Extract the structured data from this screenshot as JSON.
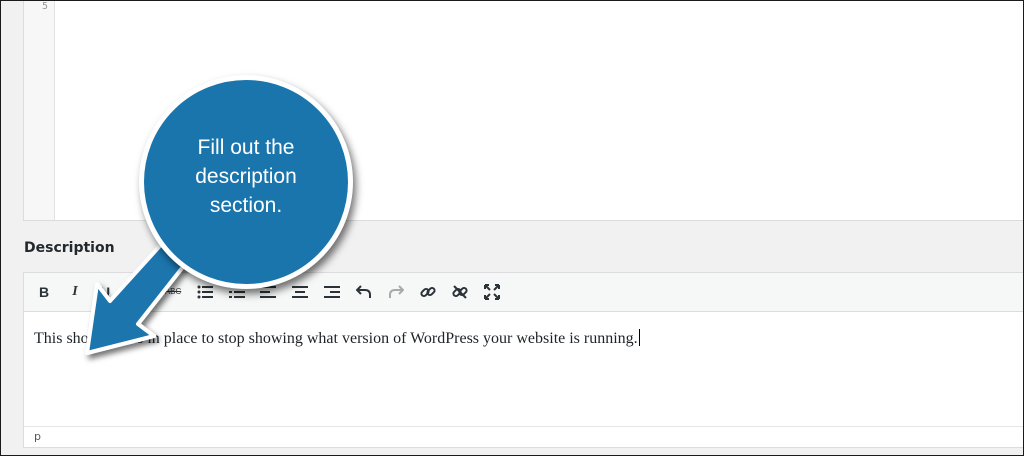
{
  "code_editor": {
    "line_number": "5"
  },
  "description_heading": "Description",
  "toolbar": {
    "bold_label": "B",
    "italic_label": "I",
    "underline_label": "U",
    "strike_label": "ABC"
  },
  "editor": {
    "content": "This shortcode is in place to stop showing what version of WordPress your website is running.",
    "path": "p"
  },
  "callout": {
    "text": "Fill out the description section.",
    "color": "#1a75ad"
  }
}
